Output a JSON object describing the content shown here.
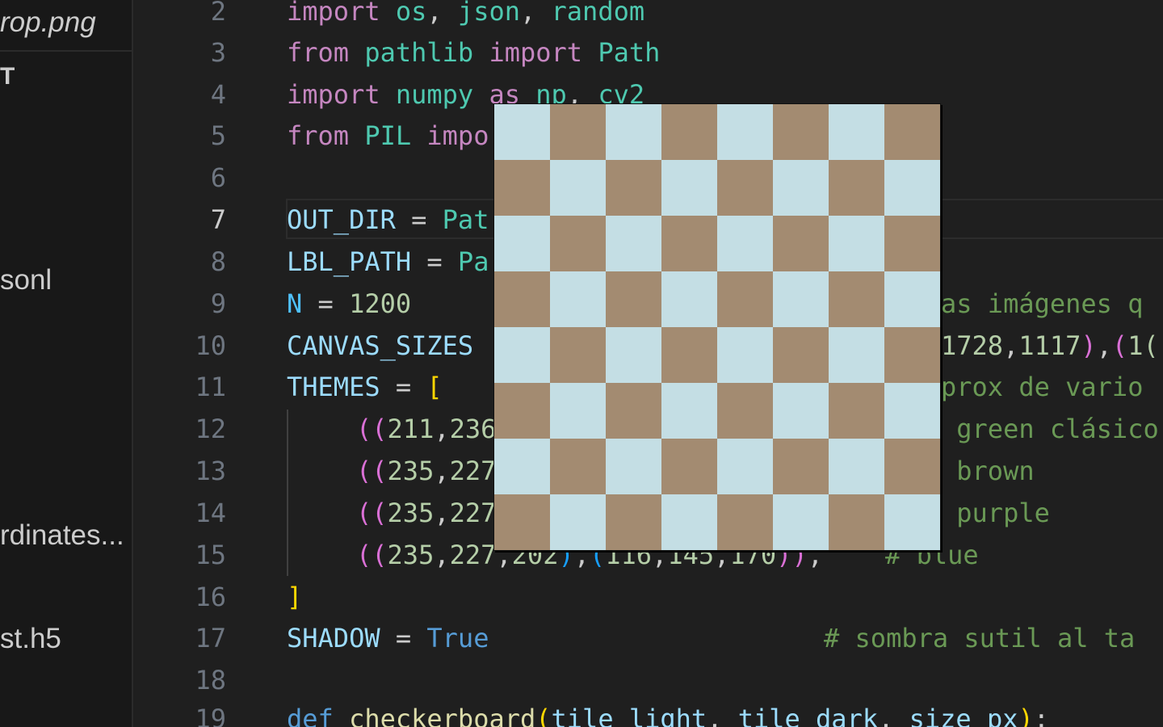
{
  "sidebar": {
    "tab_title": "rop.png",
    "items": [
      {
        "label": "T"
      },
      {
        "label": "sonl"
      },
      {
        "label": "rdinates..."
      },
      {
        "label": "st.h5"
      }
    ]
  },
  "editor": {
    "active_line": "7",
    "lines": [
      {
        "number": "2"
      },
      {
        "number": "3"
      },
      {
        "number": "4"
      },
      {
        "number": "5"
      },
      {
        "number": "6"
      },
      {
        "number": "7"
      },
      {
        "number": "8"
      },
      {
        "number": "9"
      },
      {
        "number": "10"
      },
      {
        "number": "11"
      },
      {
        "number": "12"
      },
      {
        "number": "13"
      },
      {
        "number": "14"
      },
      {
        "number": "15"
      },
      {
        "number": "16"
      },
      {
        "number": "17"
      },
      {
        "number": "18"
      },
      {
        "number": "19"
      }
    ],
    "tokens": {
      "l2": {
        "import": "import",
        "os": "os",
        "c1": ", ",
        "json": "json",
        "c2": ", ",
        "random": "random"
      },
      "l3": {
        "from": "from",
        "pathlib": "pathlib",
        "import": "import",
        "path": "Path"
      },
      "l4": {
        "import": "import",
        "numpy": "numpy",
        "as": "as",
        "np": "np",
        "c": ", ",
        "cv2": "cv2"
      },
      "l5": {
        "from": "from",
        "pil": "PIL",
        "impo": "impo"
      },
      "l7": {
        "name": "OUT_DIR",
        "eq": " = ",
        "val": "Pat"
      },
      "l8": {
        "name": "LBL_PATH",
        "eq": " = ",
        "val": "Pa"
      },
      "l9": {
        "name": "N",
        "eq": " = ",
        "num": "1200",
        "comment": "as imágenes q"
      },
      "l10": {
        "name": "CANVAS_SIZES",
        "tail_num1": "1728",
        "tail_c": ",",
        "tail_num2": "1117",
        "tail_close": ")",
        "tail_comma": ",",
        "tail_open": "(",
        "tail_num3": "1("
      },
      "l11": {
        "name": "THEMES",
        "eq": " = ",
        "bracket": "[",
        "comment": "prox de vario"
      },
      "l12": {
        "open": "((",
        "num1": "211",
        "comma": ",",
        "num2": "236",
        "comment": " green clásico"
      },
      "l13": {
        "open": "((",
        "num1": "235",
        "comma": ",",
        "num2": "227",
        "comment": " brown"
      },
      "l14": {
        "open": "((",
        "num1": "235",
        "comma": ",",
        "num2": "227",
        "comment": " purple"
      },
      "l15": {
        "open": "((",
        "n1": "235",
        "c1": ",",
        "n2": "227",
        "c2": ",",
        "n3": "202",
        "close1": ")",
        "c3": ",",
        "open2": "(",
        "n4": "116",
        "c4": ",",
        "n5": "145",
        "c5": ",",
        "n6": "170",
        "close2": "))",
        "c6": ",",
        "comment": "    # blue"
      },
      "l16": {
        "bracket": "]"
      },
      "l17": {
        "name": "SHADOW",
        "eq": " = ",
        "val": "True",
        "comment": "# sombra sutil al ta"
      },
      "l19": {
        "def": "def",
        "fn": "checkerboard",
        "open": "(",
        "a1": "tile_light",
        "c1": ", ",
        "a2": "tile_dark",
        "c2": ", ",
        "a3": "size_px",
        "close": ")",
        "colon": ":"
      }
    }
  },
  "checkerboard": {
    "rows": 8,
    "cols": 8,
    "light_color": "#c4dee4",
    "dark_color": "#a38b71"
  }
}
